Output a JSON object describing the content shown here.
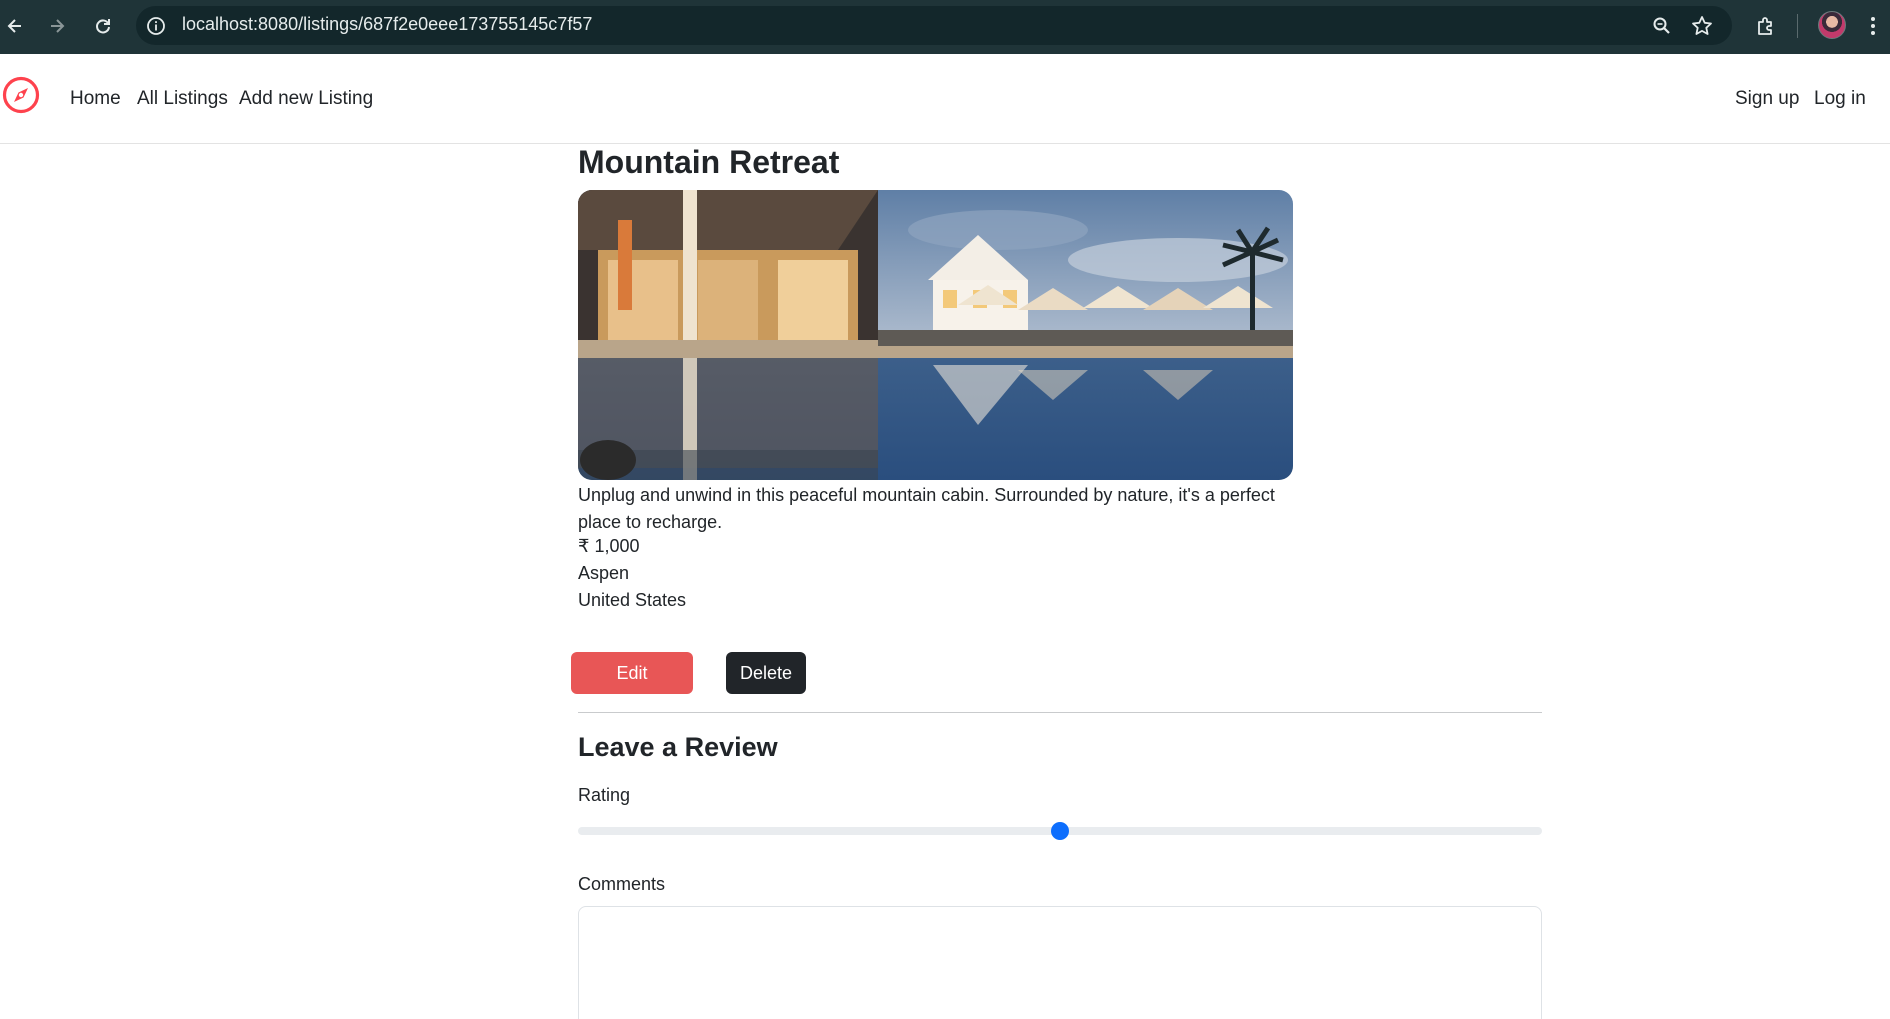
{
  "browser": {
    "url": "localhost:8080/listings/687f2e0eee173755145c7f57",
    "icons": [
      "back-arrow-icon",
      "forward-arrow-icon",
      "reload-icon",
      "site-info-icon",
      "zoom-icon",
      "bookmark-star-icon",
      "extensions-icon",
      "profile-avatar",
      "kebab-menu-icon"
    ]
  },
  "navbar": {
    "brand_icon": "compass-icon",
    "links": [
      "Home",
      "All Listings",
      "Add new Listing"
    ],
    "auth": {
      "signup": "Sign up",
      "login": "Log in"
    },
    "brand_color": "#fe424d"
  },
  "listing": {
    "title": "Mountain Retreat",
    "image_alt": "resort-pool-image",
    "description": "Unplug and unwind in this peaceful mountain cabin. Surrounded by nature, it's a perfect place to recharge.",
    "price": "₹ 1,000",
    "location": "Aspen",
    "country": "United States"
  },
  "actions": {
    "edit_label": "Edit",
    "delete_label": "Delete",
    "edit_color": "#e85656",
    "delete_color": "#212529"
  },
  "review": {
    "heading": "Leave a Review",
    "rating_label": "Rating",
    "rating_value": 0.5,
    "comments_label": "Comments",
    "comments_value": ""
  }
}
